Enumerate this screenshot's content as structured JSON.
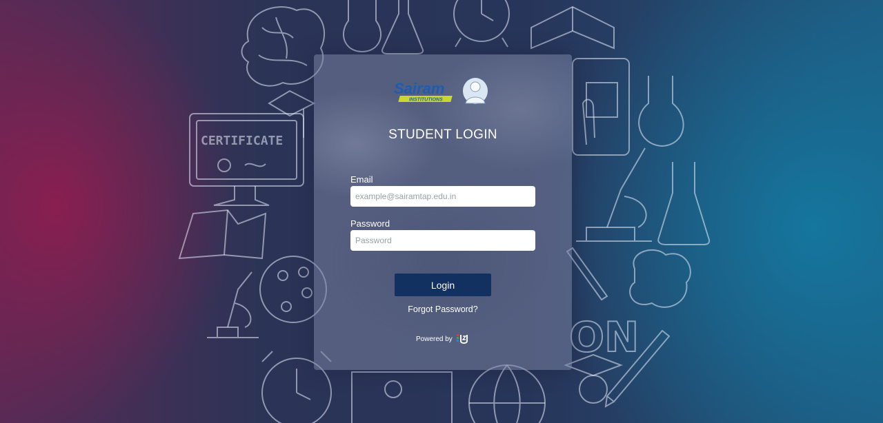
{
  "background": {
    "certificate_text": "CERTIFICATE",
    "banner_text": "ON"
  },
  "logo": {
    "brand": "Sairam",
    "sub": "INSTITUTIONS"
  },
  "page_title": "STUDENT LOGIN",
  "form": {
    "email_label": "Email",
    "email_placeholder": "example@sairamtap.edu.in",
    "email_value": "",
    "password_label": "Password",
    "password_placeholder": "Password",
    "password_value": "",
    "login_label": "Login",
    "forgot_label": "Forgot Password?"
  },
  "footer": {
    "powered_label": "Powered by"
  },
  "colors": {
    "button": "#123060",
    "logo_blue": "#1c5db0",
    "logo_yellow": "#c9d82a"
  }
}
